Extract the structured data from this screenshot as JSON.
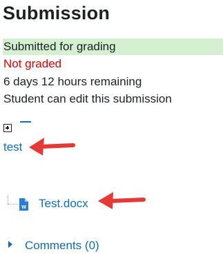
{
  "heading": {
    "title": "Submission"
  },
  "status": {
    "submission": "Submitted for grading",
    "grading": "Not graded",
    "time_remaining": "6 days 12 hours remaining",
    "edit_status": "Student can edit this submission"
  },
  "files": {
    "folder_label": "test",
    "file_name": "Test.docx"
  },
  "comments": {
    "label": "Comments (0)"
  },
  "colors": {
    "submitted_bg": "#d4f0d0",
    "not_graded": "#e00000",
    "link": "#0f6cbf",
    "annotation_arrow": "#e53935"
  },
  "icons": {
    "expand": "expand-plus-icon",
    "file": "word-document-icon",
    "comments_toggle": "caret-right-icon",
    "annotation": "red-arrow-icon"
  }
}
